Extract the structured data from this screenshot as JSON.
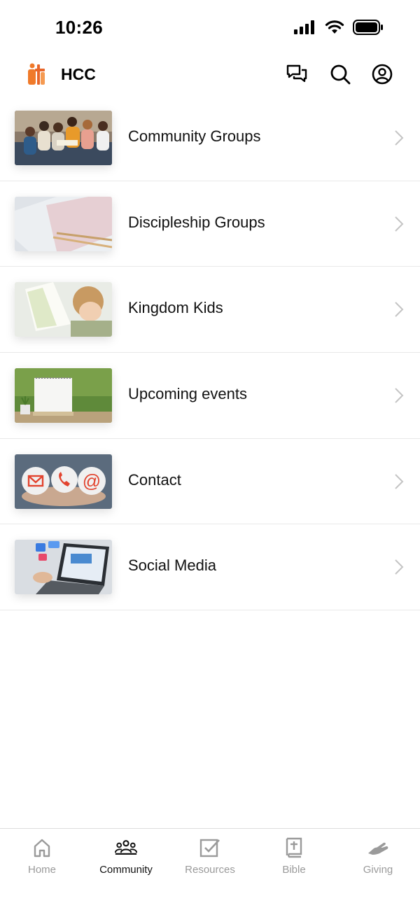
{
  "status_bar": {
    "time": "10:26"
  },
  "header": {
    "title": "HCC"
  },
  "menu": {
    "items": [
      {
        "label": "Community Groups"
      },
      {
        "label": "Discipleship Groups"
      },
      {
        "label": "Kingdom Kids"
      },
      {
        "label": "Upcoming events"
      },
      {
        "label": "Contact"
      },
      {
        "label": "Social Media"
      }
    ]
  },
  "tabs": [
    {
      "label": "Home",
      "icon": "home-icon",
      "active": false
    },
    {
      "label": "Community",
      "icon": "community-icon",
      "active": true
    },
    {
      "label": "Resources",
      "icon": "checkbox-icon",
      "active": false
    },
    {
      "label": "Bible",
      "icon": "bible-icon",
      "active": false
    },
    {
      "label": "Giving",
      "icon": "giving-hand-icon",
      "active": false
    }
  ],
  "colors": {
    "logo_orange": "#F07A2A",
    "inactive_tab": "#9A9A9A",
    "divider": "#E8E8E8"
  }
}
